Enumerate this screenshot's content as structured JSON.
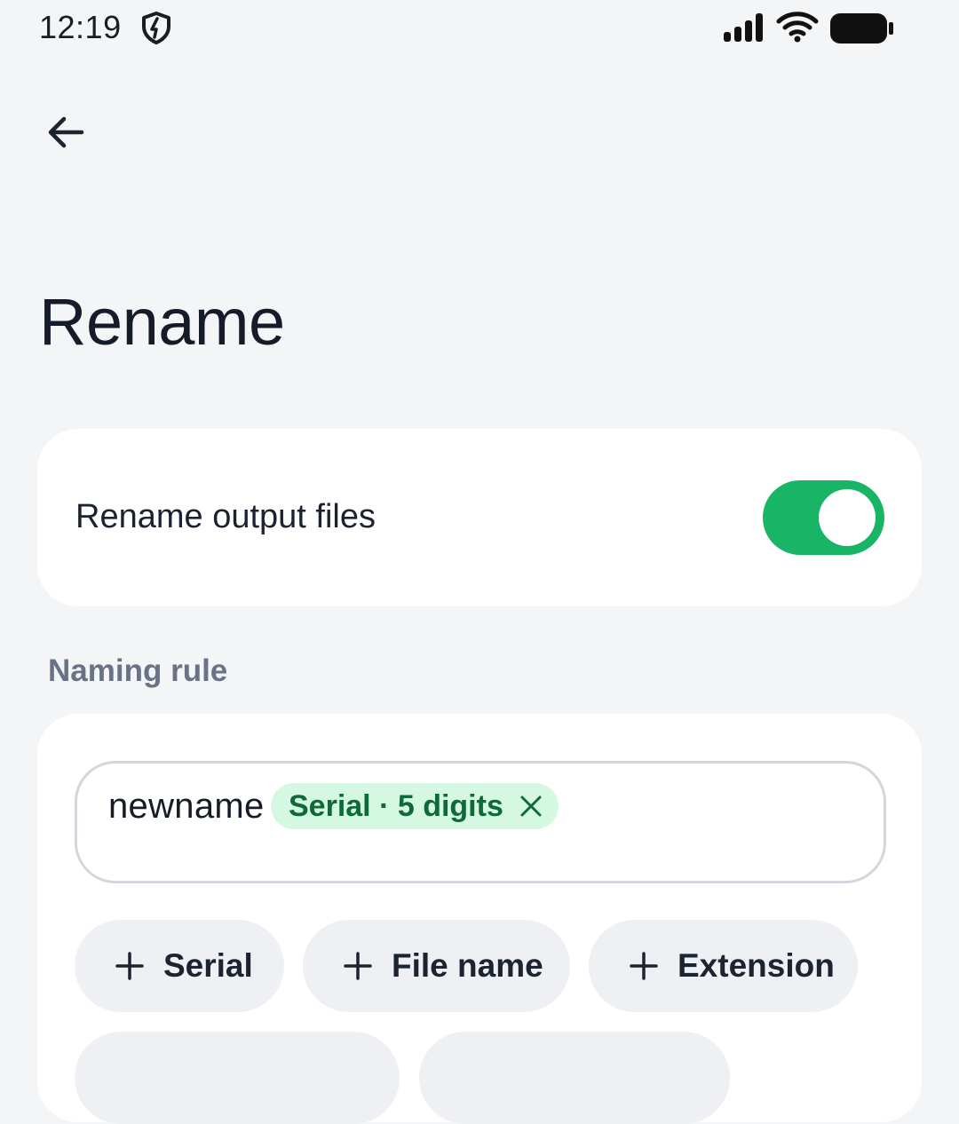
{
  "status_bar": {
    "time": "12:19",
    "icons": [
      "shield-icon",
      "signal-icon",
      "wifi-icon",
      "battery-icon"
    ]
  },
  "header": {
    "back_icon": "arrow-left-icon",
    "title": "Rename"
  },
  "rename_toggle": {
    "label": "Rename output files",
    "enabled": true,
    "accent_color": "#18b566"
  },
  "naming_rule": {
    "section_label": "Naming rule",
    "text_value": "newname",
    "chip_label": "Serial · 5 digits",
    "chip_close_icon": "close-icon",
    "add_buttons": [
      {
        "label": "Serial",
        "icon": "plus-icon"
      },
      {
        "label": "File name",
        "icon": "plus-icon"
      },
      {
        "label": "Extension",
        "icon": "plus-icon"
      }
    ]
  },
  "colors": {
    "background": "#f3f5f7",
    "card": "#ffffff",
    "chip_bg": "#d5f8e2",
    "chip_text": "#0e6a37",
    "section_label": "#6a7385",
    "button_bg": "#eef0f3"
  }
}
